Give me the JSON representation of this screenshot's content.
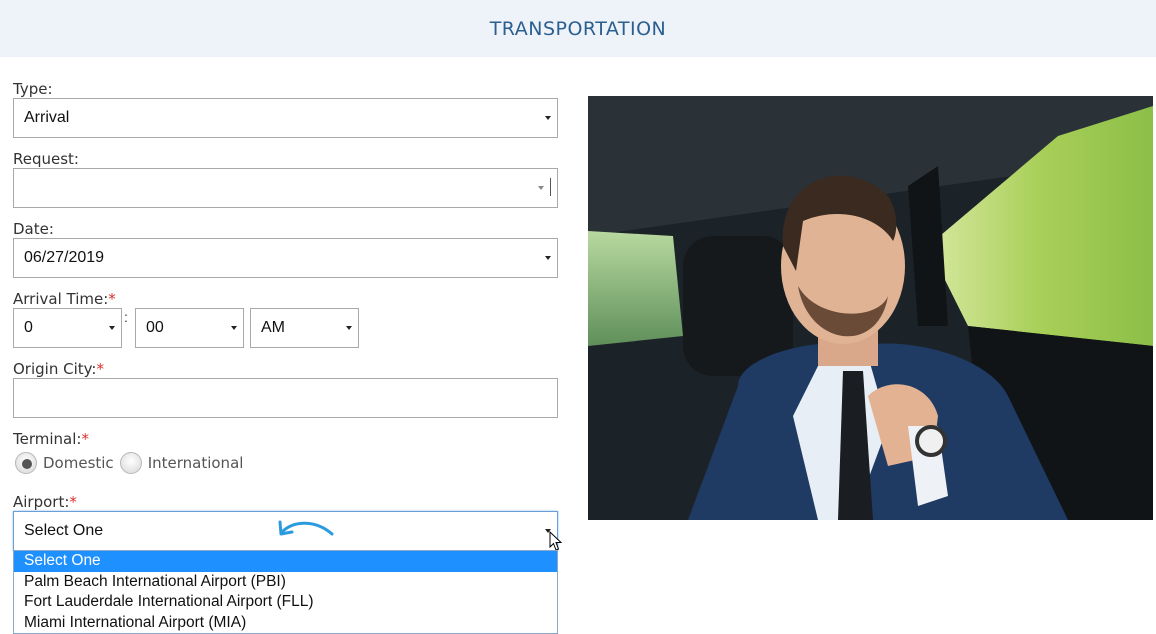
{
  "header": {
    "title": "TRANSPORTATION"
  },
  "form": {
    "type": {
      "label": "Type:",
      "value": "Arrival"
    },
    "request": {
      "label": "Request:",
      "value": ""
    },
    "date": {
      "label": "Date:",
      "value": "06/27/2019"
    },
    "arrival_time": {
      "label": "Arrival Time:",
      "required_mark": "*",
      "hour": "0",
      "separator": ":",
      "minute": "00",
      "ampm": "AM"
    },
    "origin_city": {
      "label": "Origin City:",
      "required_mark": "*",
      "value": ""
    },
    "terminal": {
      "label": "Terminal:",
      "required_mark": "*",
      "options": [
        "Domestic",
        "International"
      ],
      "selected": "Domestic"
    },
    "airport": {
      "label": "Airport:",
      "required_mark": "*",
      "value": "Select One",
      "options": [
        "Select One",
        "Palm Beach International Airport (PBI)",
        "Fort Lauderdale International Airport (FLL)",
        "Miami International Airport (MIA)"
      ],
      "highlighted": "Select One"
    }
  },
  "colors": {
    "header_bg": "#eef3fa",
    "header_text": "#2a5f8f",
    "required": "#d9302c",
    "highlight": "#1e90ff",
    "annotation_arrow": "#2b9be0"
  },
  "icons": [
    "dropdown-caret-icon",
    "curved-arrow-icon",
    "mouse-cursor-icon"
  ]
}
